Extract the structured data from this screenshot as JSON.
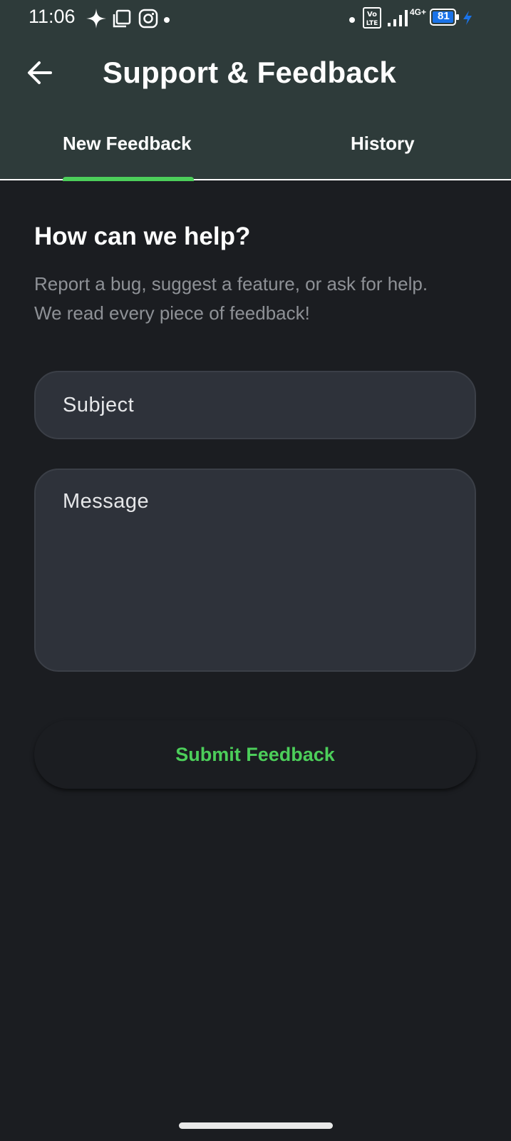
{
  "status_bar": {
    "time": "11:06",
    "network_type": "4G+",
    "volte": "Vo LTE",
    "battery_level": "81"
  },
  "app_bar": {
    "title": "Support & Feedback",
    "back_icon": "arrow-left-icon"
  },
  "tabs": [
    {
      "label": "New Feedback",
      "selected": true
    },
    {
      "label": "History",
      "selected": false
    }
  ],
  "main": {
    "heading": "How can we help?",
    "description_line1": "Report a bug, suggest a feature, or ask for help.",
    "description_line2": "We read every piece of feedback!",
    "subject_placeholder": "Subject",
    "subject_value": "",
    "message_placeholder": "Message",
    "message_value": "",
    "submit_label": "Submit Feedback"
  },
  "colors": {
    "header_bg": "#2e3b3a",
    "page_bg": "#1b1d21",
    "accent": "#4cce5a",
    "field_bg": "#2e323a",
    "battery_blue": "#1a73e8"
  }
}
